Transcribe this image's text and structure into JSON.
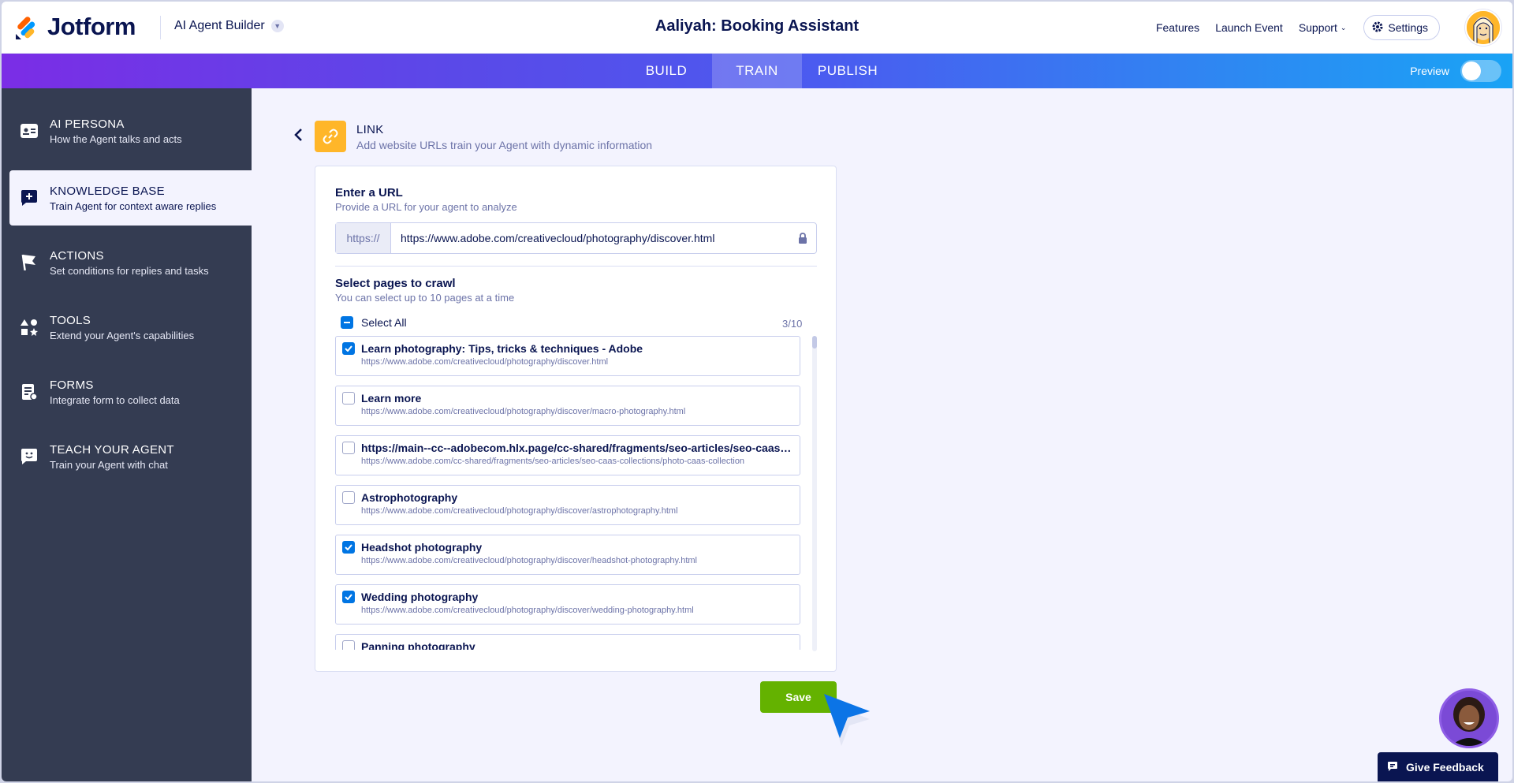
{
  "header": {
    "brand": "Jotform",
    "builder_label": "AI Agent Builder",
    "agent_title": "Aaliyah: Booking Assistant",
    "links": {
      "features": "Features",
      "launch_event": "Launch Event",
      "support": "Support"
    },
    "settings_label": "Settings"
  },
  "tabs": {
    "build": "BUILD",
    "train": "TRAIN",
    "publish": "PUBLISH",
    "active": "TRAIN"
  },
  "preview": {
    "label": "Preview",
    "enabled": false
  },
  "sidebar": {
    "items": [
      {
        "title": "AI PERSONA",
        "subtitle": "How the Agent talks and acts",
        "icon": "id-card-icon"
      },
      {
        "title": "KNOWLEDGE BASE",
        "subtitle": "Train Agent for context aware replies",
        "icon": "knowledge-chat-icon",
        "active": true
      },
      {
        "title": "ACTIONS",
        "subtitle": "Set conditions for replies and tasks",
        "icon": "flag-icon"
      },
      {
        "title": "TOOLS",
        "subtitle": "Extend your Agent's capabilities",
        "icon": "tools-shapes-icon"
      },
      {
        "title": "FORMS",
        "subtitle": "Integrate form to collect data",
        "icon": "form-icon"
      },
      {
        "title": "TEACH YOUR AGENT",
        "subtitle": "Train your Agent with chat",
        "icon": "smile-chat-icon"
      }
    ]
  },
  "link_section": {
    "title": "LINK",
    "subtitle": "Add website URLs train your Agent with dynamic information",
    "url_label": "Enter a URL",
    "url_help": "Provide a URL for your agent to analyze",
    "url_prefix": "https://",
    "url_value": "https://www.adobe.com/creativecloud/photography/discover.html",
    "crawl_label": "Select pages to crawl",
    "crawl_help": "You can select up to 10 pages at a time",
    "select_all": "Select All",
    "count": "3/10",
    "pages": [
      {
        "title": "Learn photography: Tips, tricks & techniques - Adobe",
        "url": "https://www.adobe.com/creativecloud/photography/discover.html",
        "checked": true
      },
      {
        "title": "Learn more",
        "url": "https://www.adobe.com/creativecloud/photography/discover/macro-photography.html",
        "checked": false
      },
      {
        "title": "https://main--cc--adobecom.hlx.page/cc-shared/fragments/seo-articles/seo-caas-collections/photo-caas-collection",
        "url": "https://www.adobe.com/cc-shared/fragments/seo-articles/seo-caas-collections/photo-caas-collection",
        "checked": false
      },
      {
        "title": "Astrophotography",
        "url": "https://www.adobe.com/creativecloud/photography/discover/astrophotography.html",
        "checked": false
      },
      {
        "title": "Headshot photography",
        "url": "https://www.adobe.com/creativecloud/photography/discover/headshot-photography.html",
        "checked": true
      },
      {
        "title": "Wedding photography",
        "url": "https://www.adobe.com/creativecloud/photography/discover/wedding-photography.html",
        "checked": true
      },
      {
        "title": "Panning photography",
        "url": "",
        "checked": false
      }
    ]
  },
  "save_label": "Save",
  "feedback_label": "Give Feedback",
  "colors": {
    "accent": "#0075e3",
    "save": "#64b200",
    "sidebar": "#343c52",
    "link_badge": "#ffb629",
    "navy": "#0a1551"
  }
}
